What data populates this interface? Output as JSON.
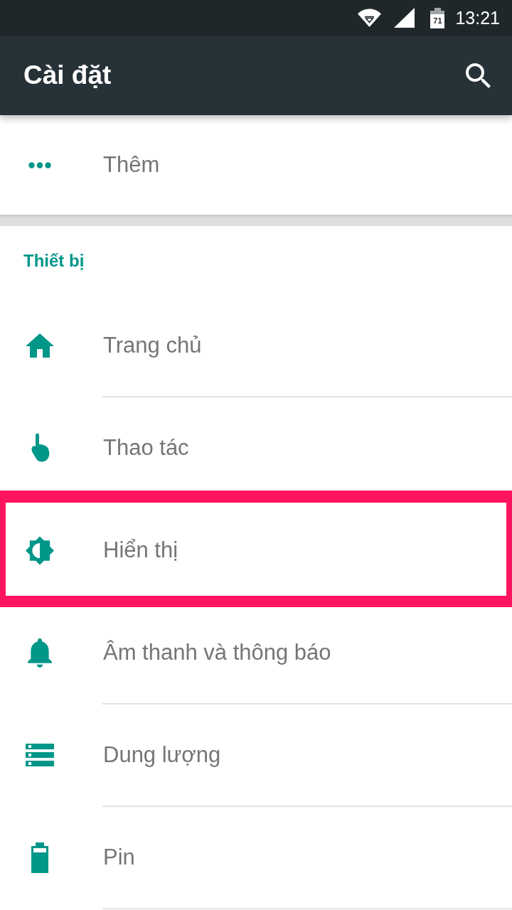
{
  "status_bar": {
    "battery_text": "71",
    "time": "13:21"
  },
  "app_bar": {
    "title": "Cài đặt"
  },
  "top_items": [
    {
      "kind": "more",
      "label": "Thêm"
    }
  ],
  "sections": [
    {
      "title": "Thiết bị",
      "items": [
        {
          "kind": "home",
          "label": "Trang chủ",
          "highlighted": false
        },
        {
          "kind": "touch",
          "label": "Thao tác",
          "highlighted": false
        },
        {
          "kind": "brightness",
          "label": "Hiển thị",
          "highlighted": true
        },
        {
          "kind": "bell",
          "label": "Âm thanh và thông báo",
          "highlighted": false
        },
        {
          "kind": "storage",
          "label": "Dung lượng",
          "highlighted": false
        },
        {
          "kind": "battery",
          "label": "Pin",
          "highlighted": false
        }
      ]
    }
  ]
}
